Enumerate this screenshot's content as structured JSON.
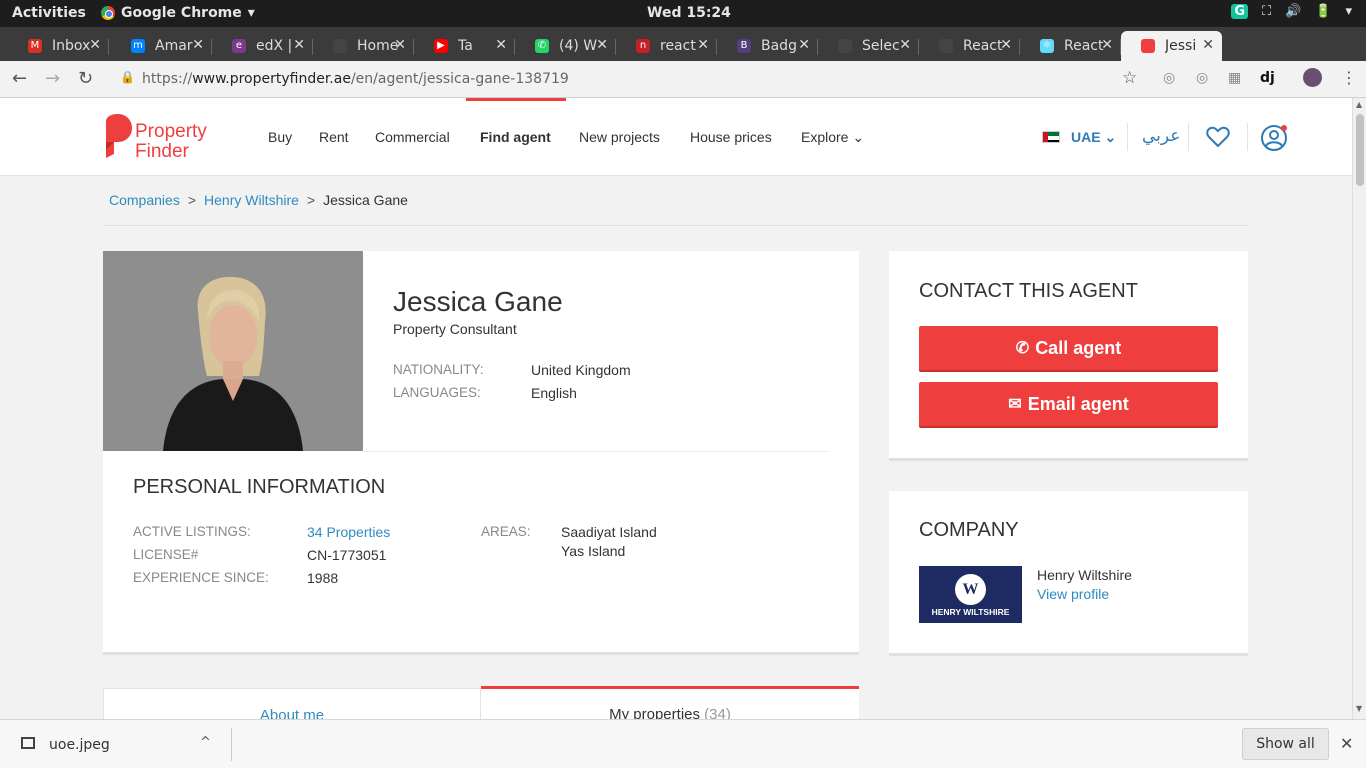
{
  "os": {
    "activities": "Activities",
    "app_name": "Google Chrome",
    "app_menu_arrow": "▾",
    "clock": "Wed 15:24",
    "tray": [
      "G",
      "⛶",
      "🔊",
      "🔋",
      "▾"
    ]
  },
  "browser": {
    "tabs": [
      {
        "label": "Inbox",
        "favicon_color": "#d93025",
        "glyph": "M"
      },
      {
        "label": "Amar",
        "favicon_color": "#0084ff",
        "glyph": "m"
      },
      {
        "label": "edX |",
        "favicon_color": "#7a3b8f",
        "glyph": "e"
      },
      {
        "label": "Home",
        "favicon_color": "#444444",
        "glyph": ""
      },
      {
        "label": "Ta",
        "favicon_color": "#ff0000",
        "glyph": "▶"
      },
      {
        "label": "(4) W",
        "favicon_color": "#25d366",
        "glyph": "✆"
      },
      {
        "label": "react",
        "favicon_color": "#c12127",
        "glyph": "n"
      },
      {
        "label": "Badg",
        "favicon_color": "#563d7c",
        "glyph": "B"
      },
      {
        "label": "Selec",
        "favicon_color": "#444444",
        "glyph": ""
      },
      {
        "label": "React",
        "favicon_color": "#444444",
        "glyph": ""
      },
      {
        "label": "React",
        "favicon_color": "#61dafb",
        "glyph": "⚛"
      },
      {
        "label": "Jessi",
        "favicon_color": "#ef3e3e",
        "glyph": ""
      }
    ],
    "close_glyph": "✕",
    "new_tab": "+",
    "url_prefix": "https://",
    "url_domain": "www.propertyfinder.ae",
    "url_path": "/en/agent/jessica-gane-138719",
    "back": "←",
    "forward": "→",
    "reload": "↻",
    "star": "☆",
    "ext_dj": "dj",
    "menu": "⋮"
  },
  "site": {
    "logo_line1": "Property",
    "logo_line2": "Finder",
    "nav": [
      "Buy",
      "Rent",
      "Commercial",
      "Find agent",
      "New projects",
      "House prices",
      "Explore"
    ],
    "explore_arrow": "⌄",
    "country": "UAE",
    "country_arrow": "⌄",
    "arabic": "عربي",
    "accent_color": "#ef3e3e",
    "link_color": "#2d8bbf"
  },
  "breadcrumb": {
    "items": [
      "Companies",
      "Henry Wiltshire",
      "Jessica Gane"
    ],
    "separator": ">"
  },
  "agent": {
    "name": "Jessica Gane",
    "role": "Property Consultant",
    "nationality_label": "NATIONALITY:",
    "nationality": "United Kingdom",
    "languages_label": "LANGUAGES:",
    "languages": "English"
  },
  "personal": {
    "title": "PERSONAL INFORMATION",
    "active_listings_label": "ACTIVE LISTINGS:",
    "active_listings": "34 Properties",
    "license_label": "LICENSE#",
    "license": "CN-1773051",
    "experience_label": "EXPERIENCE SINCE:",
    "experience": "1988",
    "areas_label": "AREAS:",
    "areas": [
      "Saadiyat Island",
      "Yas Island"
    ]
  },
  "contact": {
    "title": "CONTACT THIS AGENT",
    "call": "Call agent",
    "email": "Email agent"
  },
  "company": {
    "title": "COMPANY",
    "name": "Henry Wiltshire",
    "view_profile": "View profile",
    "logo_letter": "W",
    "logo_text": "HENRY WILTSHIRE"
  },
  "tabs": {
    "about": "About me",
    "properties": "My properties",
    "properties_count": "(34)"
  },
  "download": {
    "filename": "uoe.jpeg",
    "chevron": "^",
    "show_all": "Show all",
    "close": "✕"
  }
}
